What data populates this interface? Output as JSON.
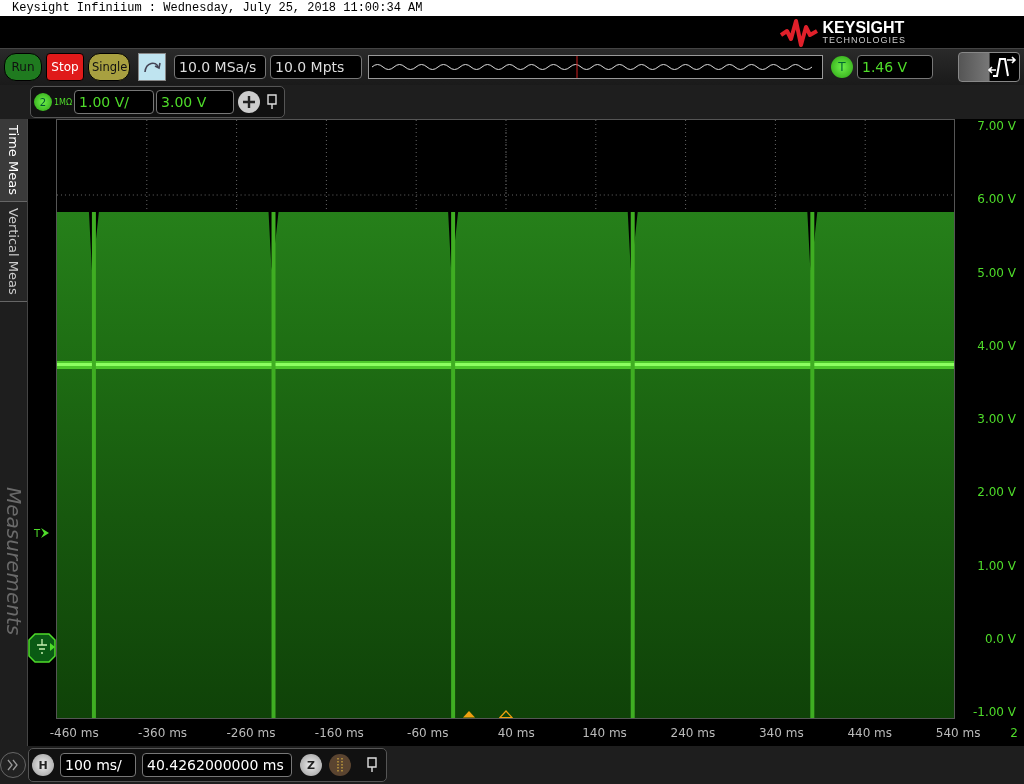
{
  "title_bar": "Keysight Infiniium : Wednesday, July 25, 2018 11:00:34 AM",
  "logo": {
    "name": "KEYSIGHT",
    "subtitle": "TECHNOLOGIES"
  },
  "toolbar": {
    "run_controls": [
      {
        "label": "Run",
        "kind": "run"
      },
      {
        "label": "Stop",
        "kind": "stop"
      },
      {
        "label": "Single",
        "kind": "single"
      }
    ],
    "sample_rate": "10.0 MSa/s",
    "memory_depth": "10.0 Mpts",
    "trigger": {
      "label": "T",
      "value": "1.46 V"
    }
  },
  "channel": {
    "number": "2",
    "impedance": "1MΩ",
    "scale": "1.00 V/",
    "offset": "3.00 V"
  },
  "side_tabs": [
    {
      "label": "Time Meas",
      "selected": true
    },
    {
      "label": "Vertical Meas",
      "selected": false
    }
  ],
  "side_panel_label": "Measurements",
  "trigger_marker": "T",
  "y_axis_labels": [
    "7.00 V",
    "6.00 V",
    "5.00 V",
    "4.00 V",
    "3.00 V",
    "2.00 V",
    "1.00 V",
    "0.0 V",
    "-1.00 V"
  ],
  "x_axis_labels": [
    "-460 ms",
    "-360 ms",
    "-260 ms",
    "-160 ms",
    "-60 ms",
    "40 ms",
    "140 ms",
    "240 ms",
    "340 ms",
    "440 ms",
    "540 ms"
  ],
  "axis_channel_label": "2",
  "horizontal": {
    "label": "H",
    "scale": "100 ms/",
    "position": "40.4262000000 ms",
    "zoom_label": "Z"
  }
}
